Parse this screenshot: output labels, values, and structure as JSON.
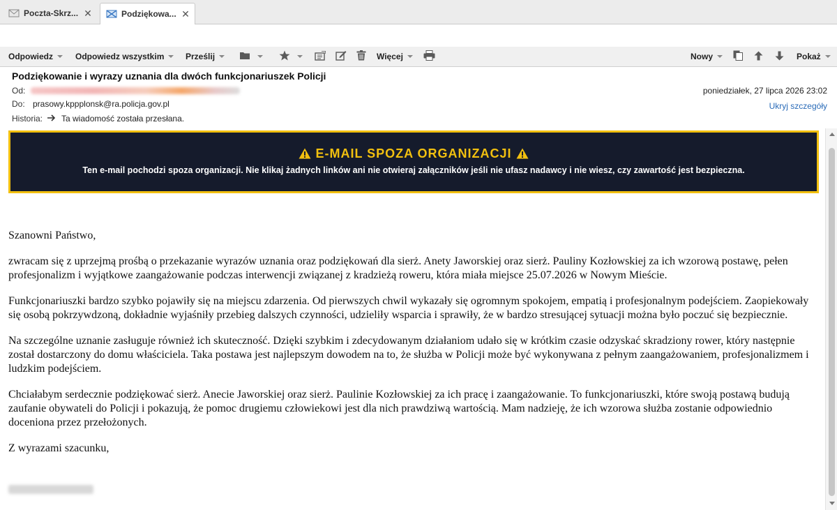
{
  "tabs": [
    {
      "label": "Poczta-Skrz...",
      "icon": "envelope-icon",
      "close": "✕"
    },
    {
      "label": "Podziękowa...",
      "icon": "envelope-x-icon",
      "close": "✕"
    }
  ],
  "toolbar": {
    "reply": "Odpowiedz",
    "reply_all": "Odpowiedz wszystkim",
    "forward": "Prześlij",
    "more": "Więcej",
    "new": "Nowy",
    "show": "Pokaż"
  },
  "header": {
    "subject": "Podziękowanie i wyrazy uznania dla dwóch funkcjonariuszek Policji",
    "from_label": "Od:",
    "to_label": "Do:",
    "to_value": "prasowy.kppplonsk@ra.policja.gov.pl",
    "history_label": "Historia:",
    "history_value": "Ta wiadomość została przesłana.",
    "date": "poniedziałek, 27 lipca 2026 23:02",
    "hide_details": "Ukryj szczegóły"
  },
  "banner": {
    "title": "E-MAIL SPOZA ORGANIZACJI",
    "text": "Ten e-mail pochodzi spoza organizacji. Nie klikaj żadnych linków ani nie otwieraj załączników jeśli nie ufasz nadawcy i nie wiesz, czy zawartość jest bezpieczna.",
    "border_color": "#f2c00f",
    "background_color": "#151b2c"
  },
  "body": {
    "greeting": "Szanowni Państwo,",
    "p1": "zwracam się z uprzejmą prośbą o przekazanie wyrazów uznania oraz podziękowań dla sierż. Anety Jaworskiej oraz sierż. Pauliny Kozłowskiej za ich wzorową postawę, pełen profesjonalizm i wyjątkowe zaangażowanie podczas interwencji związanej z kradzieżą roweru, która miała miejsce 25.07.2026 w Nowym Mieście.",
    "p2": "Funkcjonariuszki bardzo szybko pojawiły się na miejscu zdarzenia. Od pierwszych chwil wykazały się ogromnym spokojem, empatią i profesjonalnym podejściem. Zaopiekowały się osobą pokrzywdzoną, dokładnie wyjaśniły przebieg dalszych czynności, udzieliły wsparcia i sprawiły, że w bardzo stresującej sytuacji można było poczuć się bezpiecznie.",
    "p3": "Na szczególne uznanie zasługuje również ich skuteczność. Dzięki szybkim i zdecydowanym działaniom udało się w krótkim czasie odzyskać skradziony rower, który następnie został dostarczony do domu właściciela. Taka postawa jest najlepszym dowodem na to, że służba w Policji może być wykonywana z pełnym zaangażowaniem, profesjonalizmem i ludzkim podejściem.",
    "p4": "Chciałabym serdecznie podziękować sierż. Anecie Jaworskiej oraz sierż. Paulinie Kozłowskiej za ich pracę i zaangażowanie. To funkcjonariuszki, które swoją postawą budują zaufanie obywateli do Policji i pokazują, że pomoc drugiemu człowiekowi jest dla nich prawdziwą wartością. Mam nadzieję, że ich wzorowa służba zostanie odpowiednio doceniona przez przełożonych.",
    "closing": "Z wyrazami szacunku,"
  }
}
